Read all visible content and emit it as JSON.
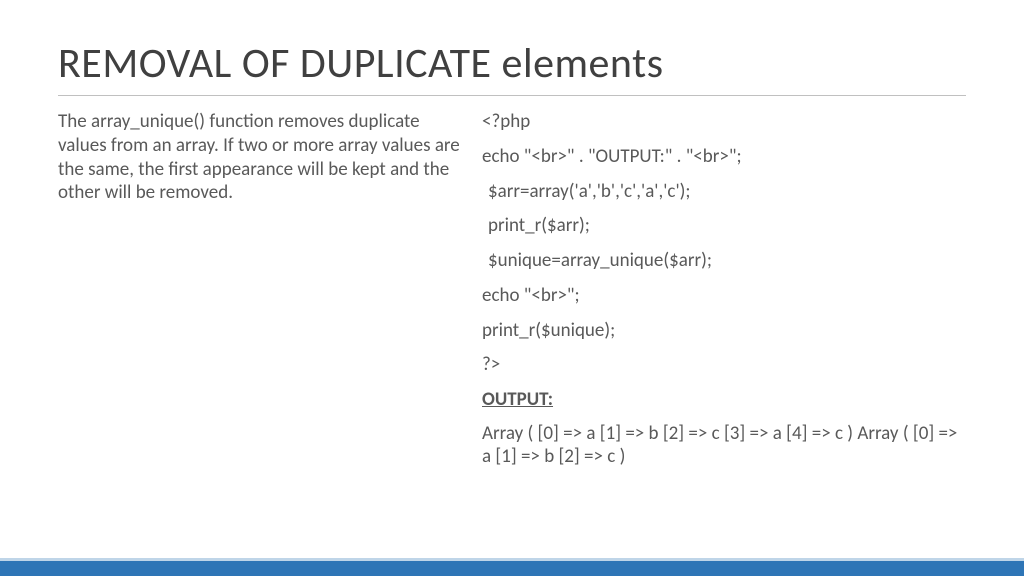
{
  "title": "REMOVAL OF DUPLICATE elements",
  "description": "The array_unique() function removes duplicate values from an array. If two or more array values are the same, the first appearance will be kept and the other will be removed.",
  "code": {
    "l1": "<?php",
    "l2": "echo \"<br>\" . \"OUTPUT:\" . \"<br>\";",
    "l3": "$arr=array('a','b','c','a','c');",
    "l4": "print_r($arr);",
    "l5": "$unique=array_unique($arr);",
    "l6": "echo \"<br>\";",
    "l7": "print_r($unique);",
    "l8": "?>"
  },
  "output_label": "OUTPUT:",
  "output_text": "Array ( [0] => a [1] => b [2] => c [3] => a [4] => c ) Array ( [0] => a [1] => b [2] => c )"
}
